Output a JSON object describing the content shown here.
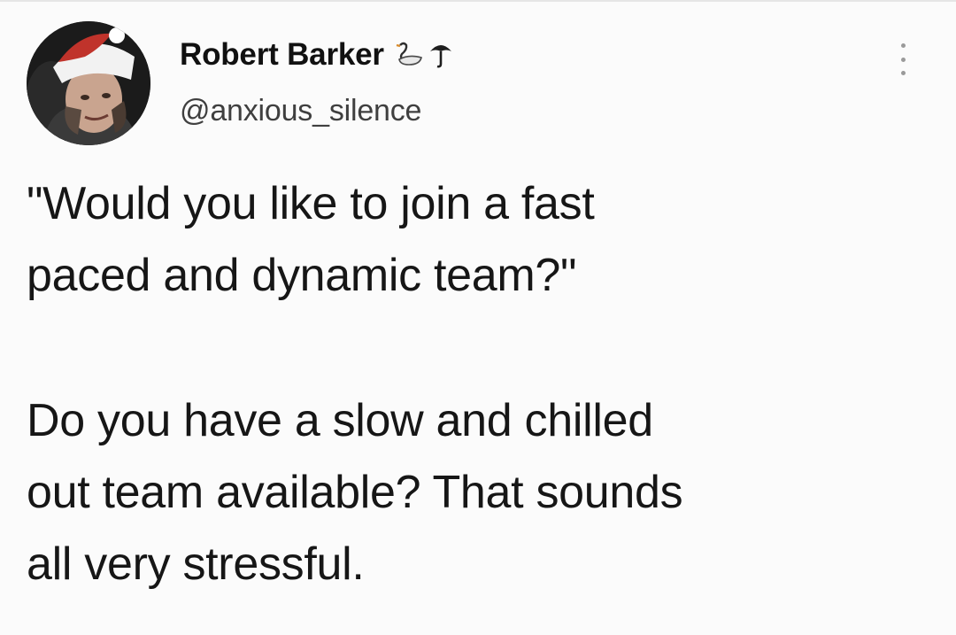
{
  "tweet": {
    "author": {
      "display_name": "Robert Barker",
      "handle": "@anxious_silence",
      "avatar": "avatar-photo",
      "name_emojis": [
        "swan-icon",
        "umbrella-icon"
      ]
    },
    "more_icon": "more-vertical-icon",
    "text": {
      "paragraph_1": {
        "line_1": "\"Would you like to join a fast",
        "line_2": "paced and dynamic team?\""
      },
      "paragraph_2": {
        "line_1": "Do you have a slow and chilled",
        "line_2": "out team available? That sounds",
        "line_3": "all very stressful."
      }
    }
  }
}
